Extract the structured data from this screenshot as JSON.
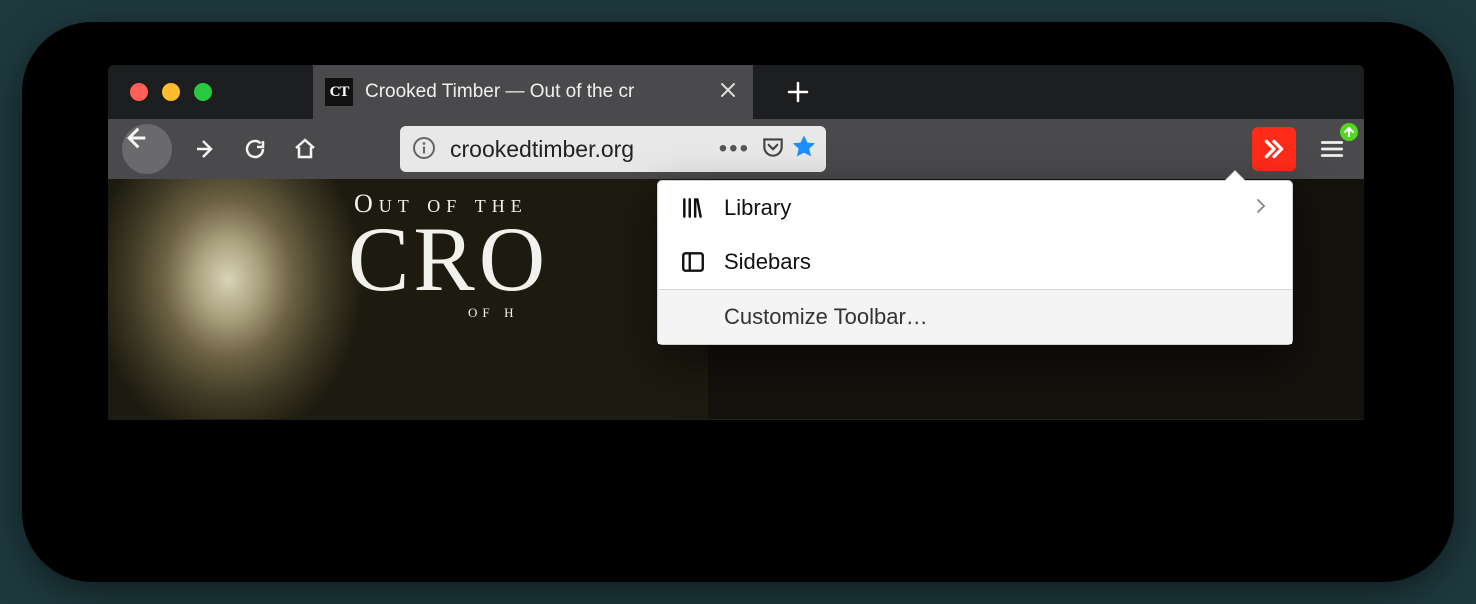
{
  "tab": {
    "favicon_text": "CT",
    "title": "Crooked Timber — Out of the cr"
  },
  "url": {
    "text": "crookedtimber.org"
  },
  "overflow_menu": {
    "library": "Library",
    "sidebars": "Sidebars",
    "customize": "Customize Toolbar…"
  },
  "banner": {
    "line1": "Out of the",
    "line2": "CRO",
    "line3": "of h"
  },
  "colors": {
    "overflow_button": "#ff2b1a",
    "star": "#1e90ff",
    "badge": "#54d722"
  }
}
